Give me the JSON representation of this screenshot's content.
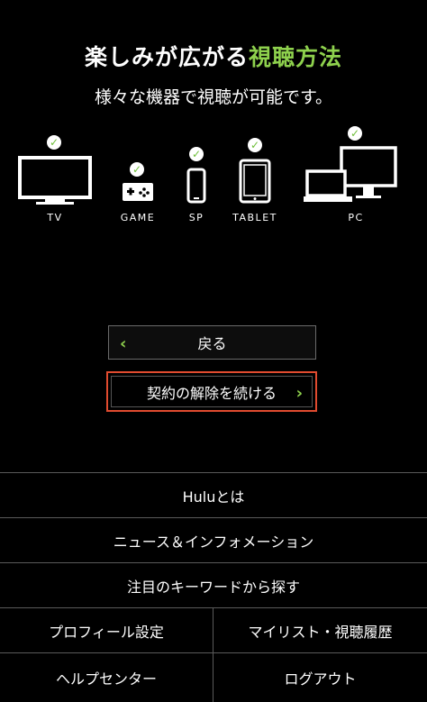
{
  "hero": {
    "title_main": "楽しみが広がる",
    "title_accent": "視聴方法",
    "subtitle": "様々な機器で視聴が可能です。"
  },
  "devices": [
    {
      "label": "TV",
      "icon": "tv-icon"
    },
    {
      "label": "GAME",
      "icon": "gamepad-icon"
    },
    {
      "label": "SP",
      "icon": "smartphone-icon"
    },
    {
      "label": "TABLET",
      "icon": "tablet-icon"
    },
    {
      "label": "PC",
      "icon": "pc-icon"
    }
  ],
  "buttons": {
    "back_label": "戻る",
    "continue_label": "契約の解除を続ける"
  },
  "menu": {
    "about": "Huluとは",
    "news": "ニュース＆インフォメーション",
    "keywords": "注目のキーワードから探す",
    "profile": "プロフィール設定",
    "mylist": "マイリスト・視聴履歴",
    "help": "ヘルプセンター",
    "logout": "ログアウト"
  },
  "colors": {
    "accent": "#8ed14d",
    "highlight_border": "#e04b2f",
    "background": "#000000"
  }
}
